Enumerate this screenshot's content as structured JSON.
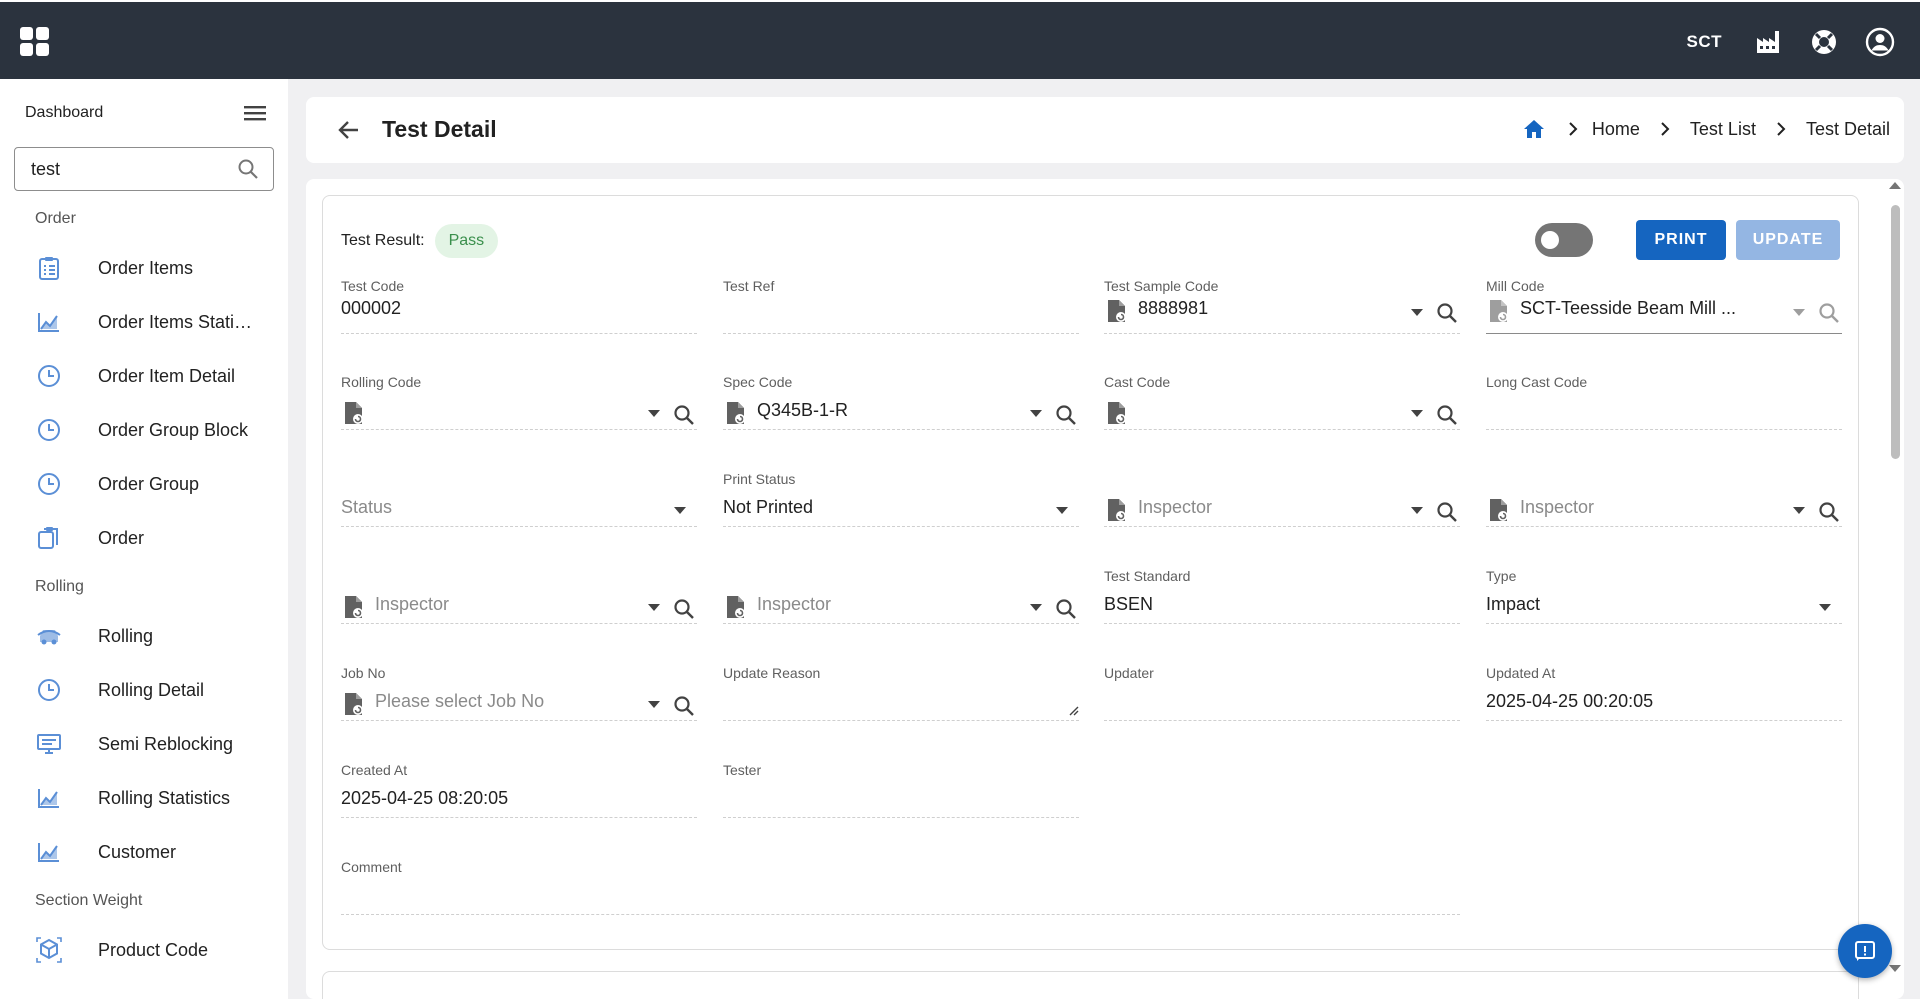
{
  "topbar": {
    "company": "SCT",
    "icons": [
      "apps-grid-icon",
      "factory-icon",
      "support-icon",
      "account-icon"
    ]
  },
  "sidebar": {
    "title": "Dashboard",
    "search_value": "test",
    "sections": [
      {
        "label": "Order",
        "items": [
          {
            "label": "Order Items",
            "icon": "clipboard-list-icon"
          },
          {
            "label": "Order Items Statistics",
            "icon": "chart-line-icon"
          },
          {
            "label": "Order Item Detail",
            "icon": "clock-icon"
          },
          {
            "label": "Order Group Block",
            "icon": "clock-icon"
          },
          {
            "label": "Order Group",
            "icon": "clock-icon"
          },
          {
            "label": "Order",
            "icon": "clipboard-copy-icon"
          }
        ]
      },
      {
        "label": "Rolling",
        "items": [
          {
            "label": "Rolling",
            "icon": "car-icon"
          },
          {
            "label": "Rolling Detail",
            "icon": "clock-icon"
          },
          {
            "label": "Semi Reblocking",
            "icon": "monitor-icon"
          },
          {
            "label": "Rolling Statistics",
            "icon": "chart-line-icon"
          },
          {
            "label": "Customer",
            "icon": "chart-line-icon"
          }
        ]
      },
      {
        "label": "Section Weight",
        "items": [
          {
            "label": "Product Code",
            "icon": "cube-icon"
          }
        ]
      }
    ]
  },
  "header": {
    "title": "Test Detail",
    "breadcrumb": [
      "Home",
      "Test List",
      "Test Detail"
    ]
  },
  "form": {
    "test_result_label": "Test Result:",
    "test_result_value": "Pass",
    "print_label": "PRINT",
    "update_label": "UPDATE",
    "test_code": {
      "label": "Test Code",
      "value": "000002"
    },
    "test_ref": {
      "label": "Test Ref",
      "value": ""
    },
    "test_sample_code": {
      "label": "Test Sample Code",
      "value": "8888981"
    },
    "mill_code": {
      "label": "Mill Code",
      "value": "SCT-Teesside Beam Mill ..."
    },
    "rolling_code": {
      "label": "Rolling Code",
      "value": ""
    },
    "spec_code": {
      "label": "Spec Code",
      "value": "Q345B-1-R"
    },
    "cast_code": {
      "label": "Cast Code",
      "value": ""
    },
    "long_cast_code": {
      "label": "Long Cast Code",
      "value": ""
    },
    "status": {
      "placeholder": "Status"
    },
    "print_status": {
      "label": "Print Status",
      "value": "Not Printed"
    },
    "inspector_1": {
      "placeholder": "Inspector"
    },
    "inspector_2": {
      "placeholder": "Inspector"
    },
    "inspector_3": {
      "placeholder": "Inspector"
    },
    "inspector_4": {
      "placeholder": "Inspector"
    },
    "test_standard": {
      "label": "Test Standard",
      "value": "BSEN"
    },
    "type": {
      "label": "Type",
      "value": "Impact"
    },
    "job_no": {
      "label": "Job No",
      "placeholder": "Please select Job No"
    },
    "update_reason": {
      "label": "Update Reason",
      "value": ""
    },
    "updater": {
      "label": "Updater",
      "value": ""
    },
    "updated_at": {
      "label": "Updated At",
      "value": "2025-04-25 00:20:05"
    },
    "created_at": {
      "label": "Created At",
      "value": "2025-04-25 08:20:05"
    },
    "tester": {
      "label": "Tester",
      "value": ""
    },
    "comment": {
      "label": "Comment",
      "value": ""
    }
  },
  "colors": {
    "topbar": "#2b333e",
    "primary": "#1565c0",
    "badge_bg": "#e3f4e5",
    "badge_text": "#3a8f4c"
  }
}
